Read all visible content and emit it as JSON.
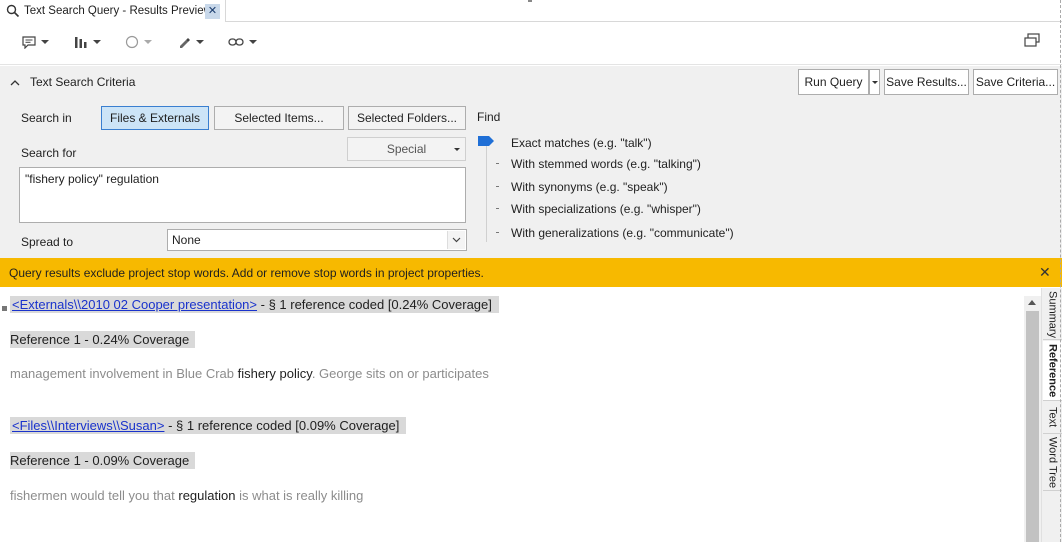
{
  "tab": {
    "title": "Text Search Query - Results Preview",
    "close_icon": "close-icon"
  },
  "toolbar": {
    "icons": [
      "comment-icon",
      "chart-icon",
      "shape-icon",
      "highlight-icon",
      "link-icon",
      "window-restore-icon"
    ]
  },
  "criteria": {
    "header": "Text Search Criteria",
    "run_query": "Run Query",
    "save_results": "Save Results...",
    "save_criteria": "Save Criteria...",
    "search_in_label": "Search in",
    "search_in_options": [
      "Files & Externals",
      "Selected Items...",
      "Selected Folders..."
    ],
    "search_for_label": "Search for",
    "special_label": "Special",
    "search_text": "\"fishery policy\" regulation",
    "spread_label": "Spread to",
    "spread_value": "None",
    "find_label": "Find",
    "find_options": [
      "Exact matches (e.g. \"talk\")",
      "With stemmed words (e.g. \"talking\")",
      "With synonyms (e.g. \"speak\")",
      "With specializations (e.g. \"whisper\")",
      "With generalizations (e.g. \"communicate\")"
    ]
  },
  "notification": {
    "message": "Query results exclude project stop words. Add or remove stop words in project properties."
  },
  "results": [
    {
      "source": "<Externals\\\\2010 02 Cooper presentation>",
      "summary": " - § 1 reference coded  [0.24% Coverage]",
      "reference": "Reference 1 - 0.24% Coverage",
      "text_before": "management involvement in Blue Crab ",
      "text_match": "fishery policy",
      "text_after": ". George sits on or participates"
    },
    {
      "source": "<Files\\\\Interviews\\\\Susan>",
      "summary": " - § 1 reference coded  [0.09% Coverage]",
      "reference": "Reference 1 - 0.09% Coverage",
      "text_before": "fishermen would tell you that ",
      "text_match": "regulation",
      "text_after": " is what is really killing"
    }
  ],
  "side_tabs": [
    "Summary",
    "Reference",
    "Text",
    "Word Tree"
  ]
}
